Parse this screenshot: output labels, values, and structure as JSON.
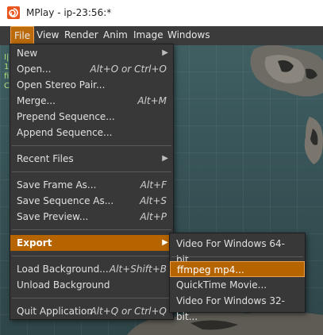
{
  "window": {
    "title": "MPlay - ip-23:56:*",
    "app_icon": "houdini-spiral-icon",
    "accent_color": "#bb6a0c"
  },
  "menubar": {
    "items": [
      {
        "label": "File",
        "active": true
      },
      {
        "label": "View"
      },
      {
        "label": "Render"
      },
      {
        "label": "Anim"
      },
      {
        "label": "Image"
      },
      {
        "label": "Windows"
      }
    ]
  },
  "file_menu": {
    "items": [
      {
        "label": "New",
        "shortcut": "",
        "submenu": true
      },
      {
        "label": "Open...",
        "shortcut": "Alt+O or Ctrl+O"
      },
      {
        "label": "Open Stereo Pair...",
        "shortcut": ""
      },
      {
        "label": "Merge...",
        "shortcut": "Alt+M"
      },
      {
        "label": "Prepend Sequence...",
        "shortcut": ""
      },
      {
        "label": "Append Sequence...",
        "shortcut": ""
      },
      {
        "label": "Recent Files",
        "shortcut": "",
        "submenu": true
      },
      {
        "label": "Save Frame As...",
        "shortcut": "Alt+F"
      },
      {
        "label": "Save Sequence As...",
        "shortcut": "Alt+S"
      },
      {
        "label": "Save Preview...",
        "shortcut": "Alt+P"
      },
      {
        "label": "Export",
        "shortcut": "",
        "submenu": true,
        "highlighted": true
      },
      {
        "label": "Load Background...",
        "shortcut": "Alt+Shift+B"
      },
      {
        "label": "Unload Background",
        "shortcut": ""
      },
      {
        "label": "Quit Application",
        "shortcut": "Alt+Q or Ctrl+Q"
      }
    ]
  },
  "export_menu": {
    "items": [
      {
        "label": "Video For Windows 64-bit..."
      },
      {
        "label": "ffmpeg mp4...",
        "highlighted": true
      },
      {
        "label": "QuickTime Movie..."
      },
      {
        "label": "Video For Windows 32-bit..."
      }
    ]
  },
  "viewport": {
    "overlay_text": [
      "I|",
      "1",
      "fi",
      "C"
    ],
    "label_color": "#b8e07a"
  }
}
